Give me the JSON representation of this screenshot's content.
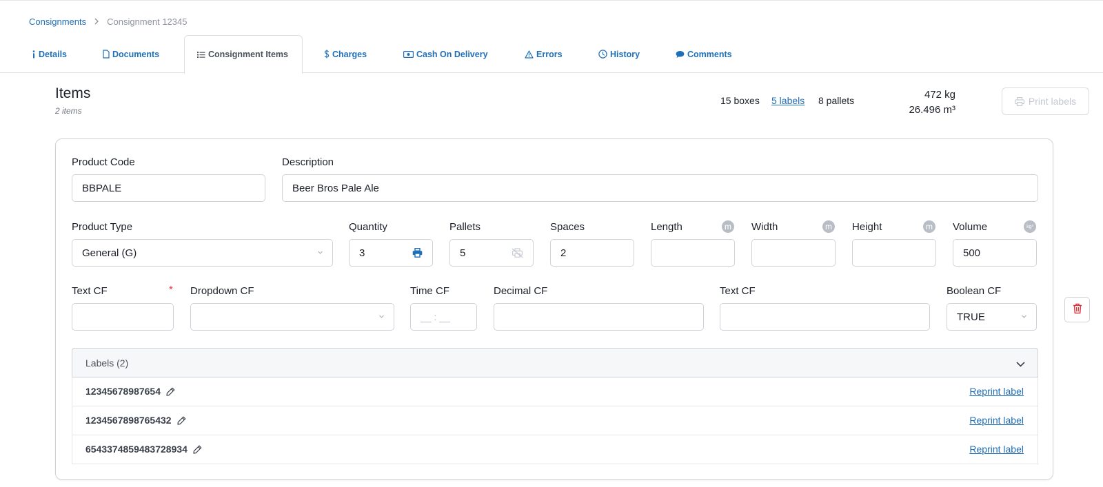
{
  "breadcrumb": {
    "parent": "Consignments",
    "current": "Consignment 12345"
  },
  "tabs": [
    {
      "label": "Details",
      "icon": "info-icon"
    },
    {
      "label": "Documents",
      "icon": "document-icon"
    },
    {
      "label": "Consignment Items",
      "icon": "list-icon",
      "active": true
    },
    {
      "label": "Charges",
      "icon": "dollar-icon"
    },
    {
      "label": "Cash On Delivery",
      "icon": "cash-icon"
    },
    {
      "label": "Errors",
      "icon": "warning-icon"
    },
    {
      "label": "History",
      "icon": "clock-icon"
    },
    {
      "label": "Comments",
      "icon": "comment-icon"
    }
  ],
  "items_header": {
    "title": "Items",
    "count": "2 items",
    "boxes": "15 boxes",
    "labels": "5 labels",
    "pallets": "8 pallets",
    "weight": "472 kg",
    "volume": "26.496 m³",
    "print_labels": "Print labels"
  },
  "item": {
    "product_code": {
      "label": "Product Code",
      "value": "BBPALE"
    },
    "description": {
      "label": "Description",
      "value": "Beer Bros Pale Ale"
    },
    "product_type": {
      "label": "Product Type",
      "value": "General (G)"
    },
    "quantity": {
      "label": "Quantity",
      "value": "3"
    },
    "pallets": {
      "label": "Pallets",
      "value": "5"
    },
    "spaces": {
      "label": "Spaces",
      "value": "2"
    },
    "length": {
      "label": "Length",
      "value": "",
      "unit": "m"
    },
    "width": {
      "label": "Width",
      "value": "",
      "unit": "m"
    },
    "height": {
      "label": "Height",
      "value": "",
      "unit": "m"
    },
    "volume": {
      "label": "Volume",
      "value": "500",
      "unit": "kg³"
    },
    "text_cf_1": {
      "label": "Text CF",
      "value": "",
      "required": "*"
    },
    "dropdown_cf": {
      "label": "Dropdown CF",
      "value": ""
    },
    "time_cf": {
      "label": "Time CF",
      "placeholder": "__ : __"
    },
    "decimal_cf": {
      "label": "Decimal CF",
      "value": ""
    },
    "text_cf_2": {
      "label": "Text CF",
      "value": ""
    },
    "boolean_cf": {
      "label": "Boolean CF",
      "value": "TRUE"
    }
  },
  "labels_panel": {
    "title": "Labels (2)",
    "rows": [
      {
        "code": "12345678987654",
        "action": "Reprint label"
      },
      {
        "code": "1234567898765432",
        "action": "Reprint label"
      },
      {
        "code": "6543374859483728934",
        "action": "Reprint label"
      }
    ]
  },
  "colors": {
    "link": "#1f6fb8",
    "delete": "#d9363e",
    "border": "#cfd3d9"
  }
}
